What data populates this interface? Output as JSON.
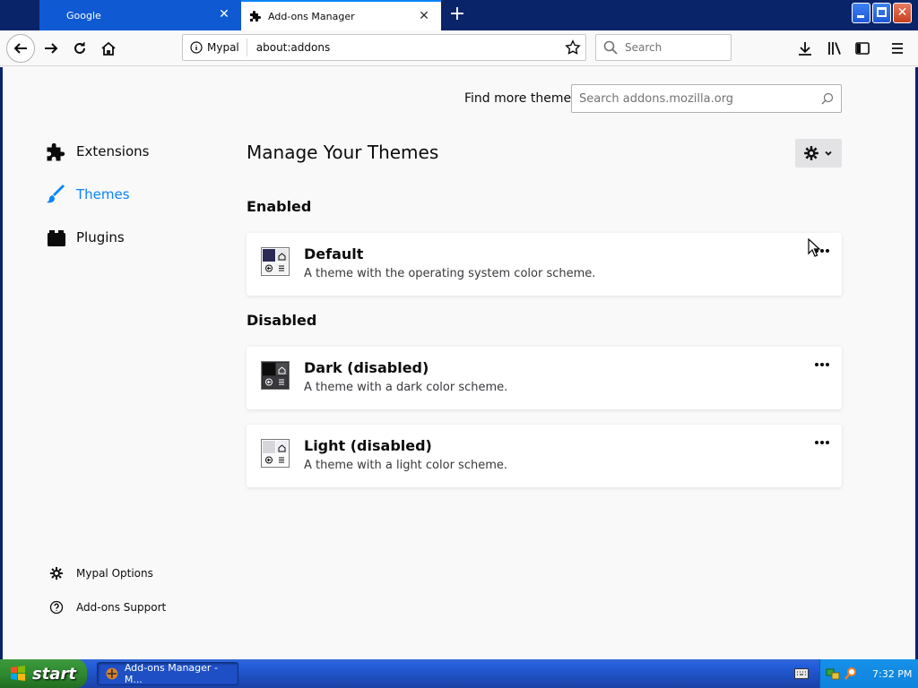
{
  "tabs": [
    {
      "label": "Google",
      "active": false
    },
    {
      "label": "Add-ons Manager",
      "active": true
    }
  ],
  "navbar": {
    "identity_label": "Mypal",
    "url": "about:addons",
    "search_placeholder": "Search"
  },
  "content": {
    "find_label": "Find more themes",
    "find_placeholder": "Search addons.mozilla.org",
    "categories": [
      {
        "label": "Extensions",
        "selected": false
      },
      {
        "label": "Themes",
        "selected": true
      },
      {
        "label": "Plugins",
        "selected": false
      }
    ],
    "footer_links": [
      "Mypal Options",
      "Add-ons Support"
    ],
    "page_title": "Manage Your Themes",
    "enabled_heading": "Enabled",
    "disabled_heading": "Disabled",
    "themes": [
      {
        "name": "Default",
        "description": "A theme with the operating system color scheme."
      },
      {
        "name": "Dark (disabled)",
        "description": "A theme with a dark color scheme."
      },
      {
        "name": "Light (disabled)",
        "description": "A theme with a light color scheme."
      }
    ]
  },
  "taskbar": {
    "start_label": "start",
    "task_label": "Add-ons Manager - M...",
    "clock": "7:32 PM"
  },
  "colors": {
    "accent": "#0a84ff",
    "titlebar": "#0a246a",
    "inactive_tab": "#0f59d3"
  }
}
